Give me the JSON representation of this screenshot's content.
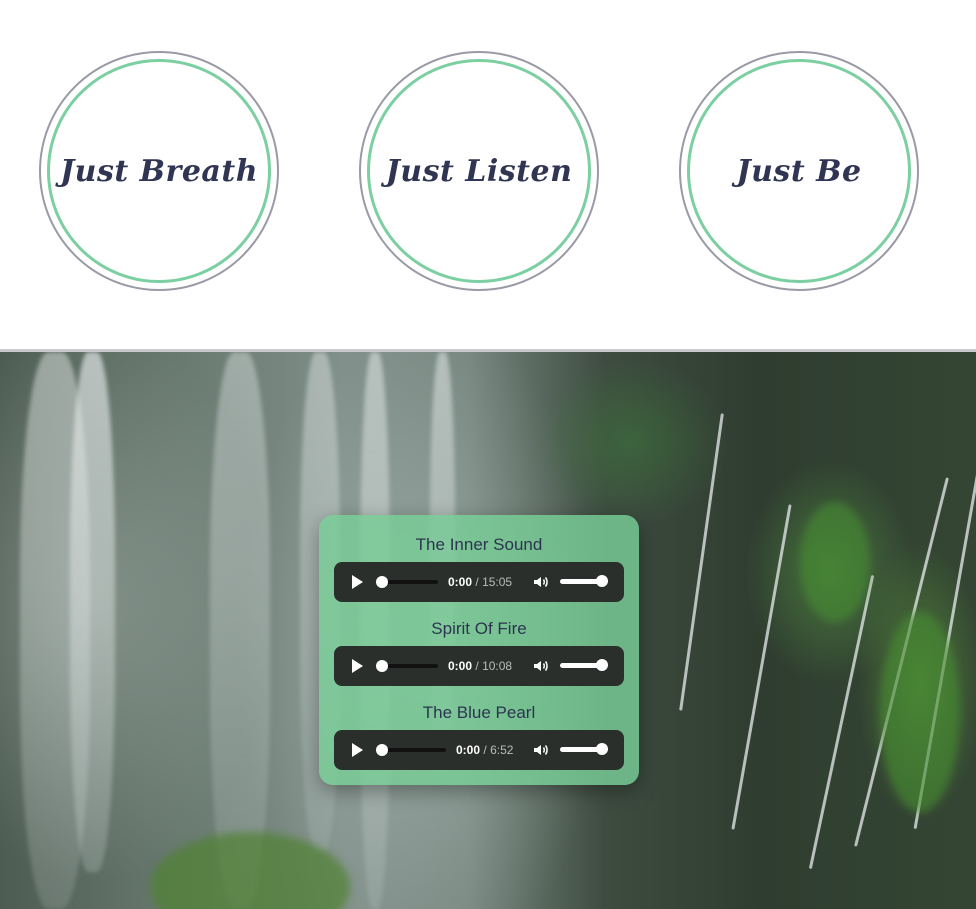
{
  "circles": [
    {
      "label": "Just Breath"
    },
    {
      "label": "Just Listen"
    },
    {
      "label": "Just Be"
    }
  ],
  "colors": {
    "circle_outer": "#9a9aa6",
    "circle_inner": "#7ccfa0",
    "label_text": "#2f3552",
    "card_bg": "#78cd96",
    "player_bg": "#2b2f2c"
  },
  "tracks": [
    {
      "title": "The Inner Sound",
      "current": "0:00",
      "separator": "/",
      "duration": "15:05"
    },
    {
      "title": "Spirit Of Fire",
      "current": "0:00",
      "separator": "/",
      "duration": "10:08"
    },
    {
      "title": "The Blue Pearl",
      "current": "0:00",
      "separator": "/",
      "duration": "6:52"
    }
  ],
  "icons": {
    "play": "play-icon",
    "volume": "volume-icon"
  }
}
